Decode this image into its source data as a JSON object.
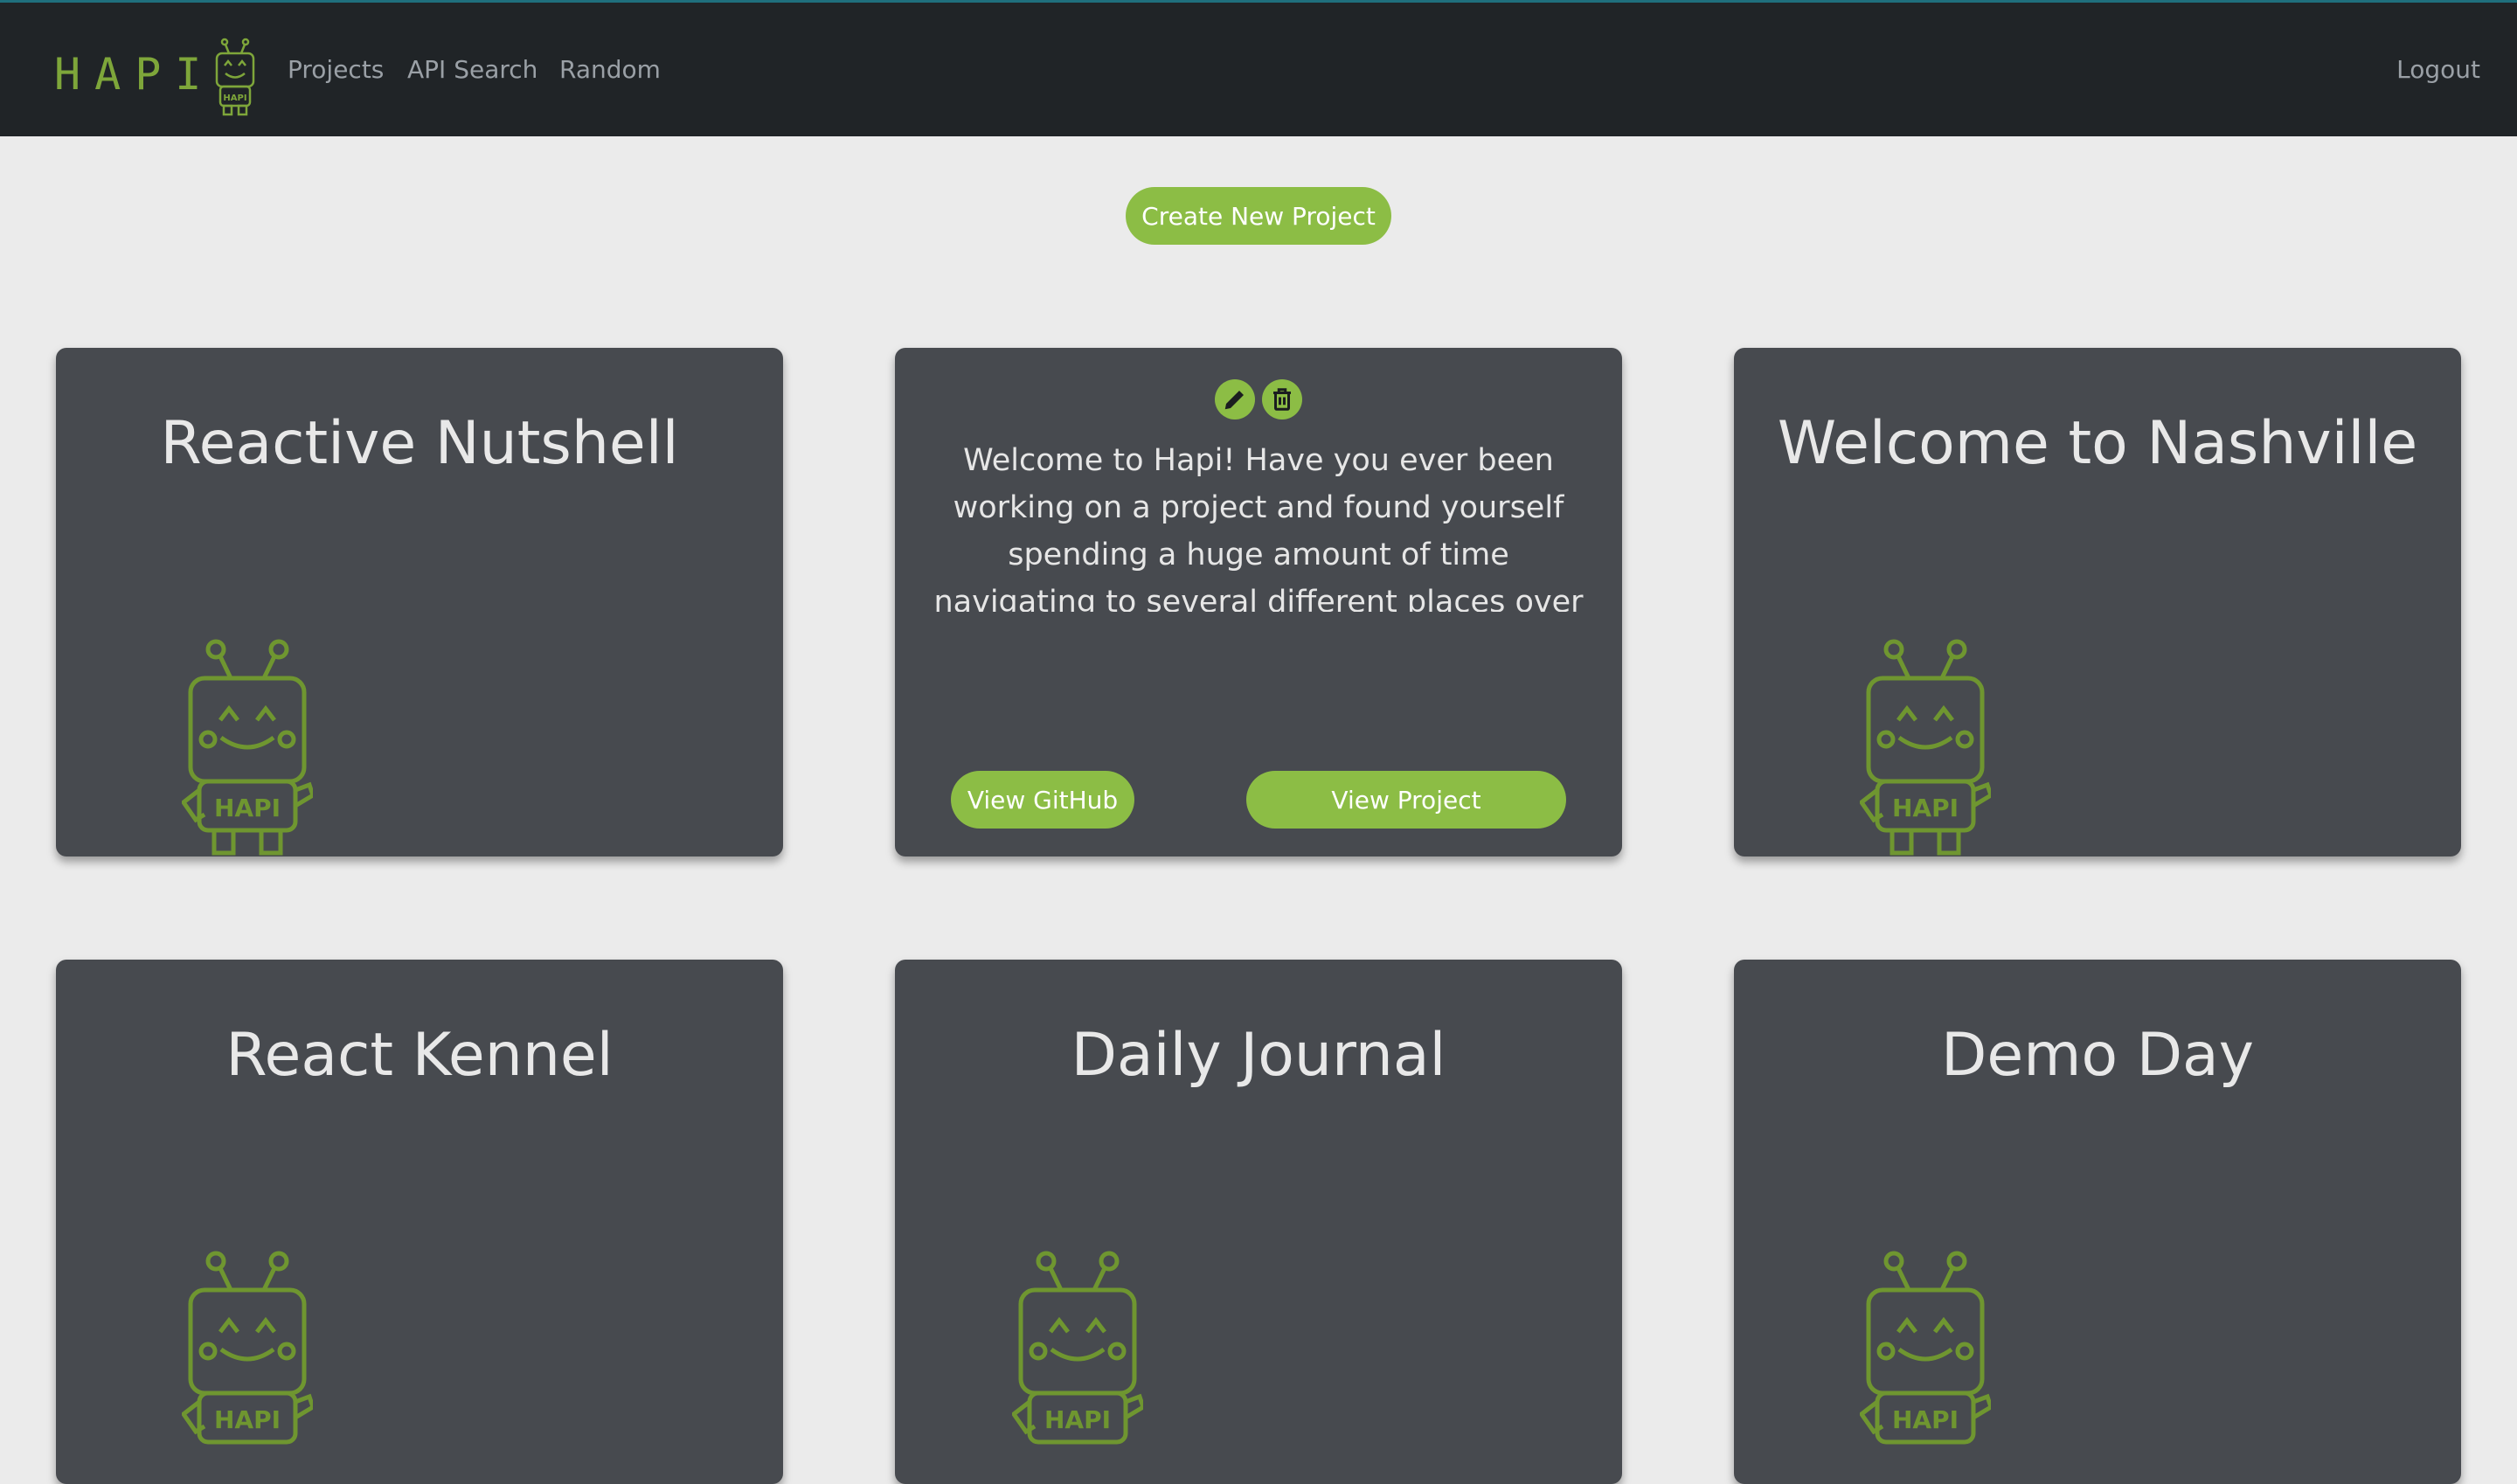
{
  "nav": {
    "logo_text": "HAPI",
    "links": [
      "Projects",
      "API Search",
      "Random"
    ],
    "logout": "Logout"
  },
  "create_button": "Create New Project",
  "mascot_badge": "HAPI",
  "projects": [
    {
      "title": "Reactive Nutshell"
    },
    {
      "description": "Welcome to Hapi! Have you ever been working on a project and found yourself spending a huge amount of time navigating to several different places over and over again to find technology documentation, the project github account, wireframes, or entity relationship diagrams? Would you like a way to keep the",
      "github_button": "View GitHub",
      "project_button": "View Project",
      "edit_icon": "pencil-icon",
      "delete_icon": "trash-icon"
    },
    {
      "title": "Welcome to Nashville"
    },
    {
      "title": "React Kennel"
    },
    {
      "title": "Daily Journal"
    },
    {
      "title": "Demo Day"
    }
  ],
  "colors": {
    "accent": "#8cbd45",
    "navbar": "#202427",
    "card": "#474a4f",
    "background": "#ebebeb"
  }
}
